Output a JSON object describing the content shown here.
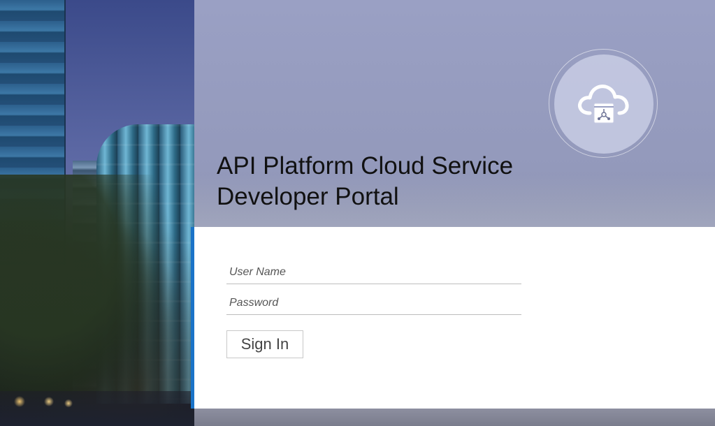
{
  "title": {
    "line1": "API Platform Cloud Service",
    "line2": "Developer Portal"
  },
  "logo": {
    "icon": "cloud-api-icon"
  },
  "login": {
    "username_placeholder": "User Name",
    "password_placeholder": "Password",
    "signin_label": "Sign In"
  },
  "colors": {
    "accent": "#1a73c8",
    "card": "#ffffff"
  }
}
